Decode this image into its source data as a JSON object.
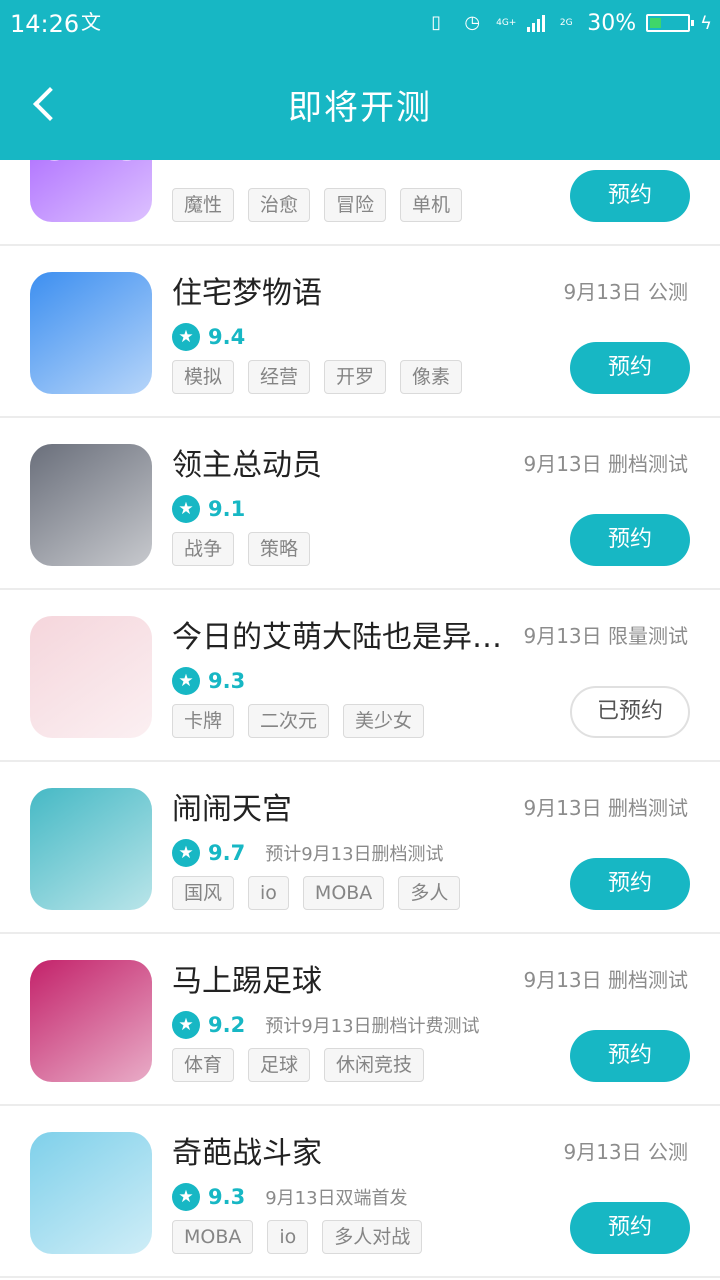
{
  "status_bar": {
    "time": "14:26",
    "lang_icon": "文",
    "net_top": "4G+",
    "net_bottom": "2G",
    "battery": "30%"
  },
  "header": {
    "title": "即将开测"
  },
  "games": [
    {
      "name": "",
      "date": "",
      "score": "",
      "note": "",
      "tags": [
        "魔性",
        "治愈",
        "冒险",
        "单机"
      ],
      "button": "预约",
      "icon_text": "OWO",
      "icon_color": "#a45cff"
    },
    {
      "name": "住宅梦物语",
      "date": "9月13日 公测",
      "score": "9.4",
      "note": "",
      "tags": [
        "模拟",
        "经营",
        "开罗",
        "像素"
      ],
      "button": "预约",
      "icon_color": "#3d8ff0"
    },
    {
      "name": "领主总动员",
      "date": "9月13日 删档测试",
      "score": "9.1",
      "note": "",
      "tags": [
        "战争",
        "策略"
      ],
      "button": "预约",
      "icon_color": "#6a6f7b"
    },
    {
      "name": "今日的艾萌大陆也是异常...",
      "date": "9月13日 限量测试",
      "score": "9.3",
      "note": "",
      "tags": [
        "卡牌",
        "二次元",
        "美少女"
      ],
      "button": "已预约",
      "icon_color": "#f5d6dc"
    },
    {
      "name": "闹闹天宫",
      "date": "9月13日 删档测试",
      "score": "9.7",
      "note": "预计9月13日删档测试",
      "tags": [
        "国风",
        "io",
        "MOBA",
        "多人"
      ],
      "button": "预约",
      "icon_color": "#46b9c5"
    },
    {
      "name": "马上踢足球",
      "date": "9月13日 删档测试",
      "score": "9.2",
      "note": "预计9月13日删档计费测试",
      "tags": [
        "体育",
        "足球",
        "休闲竞技"
      ],
      "button": "预约",
      "icon_color": "#c3226a"
    },
    {
      "name": "奇葩战斗家",
      "date": "9月13日 公测",
      "score": "9.3",
      "note": "9月13日双端首发",
      "tags": [
        "MOBA",
        "io",
        "多人对战"
      ],
      "button": "预约",
      "icon_color": "#7fd0ea"
    }
  ],
  "colors": {
    "accent": "#17b7c4",
    "tag_border": "#dadada",
    "reserved_border": "#e0e0e0"
  }
}
